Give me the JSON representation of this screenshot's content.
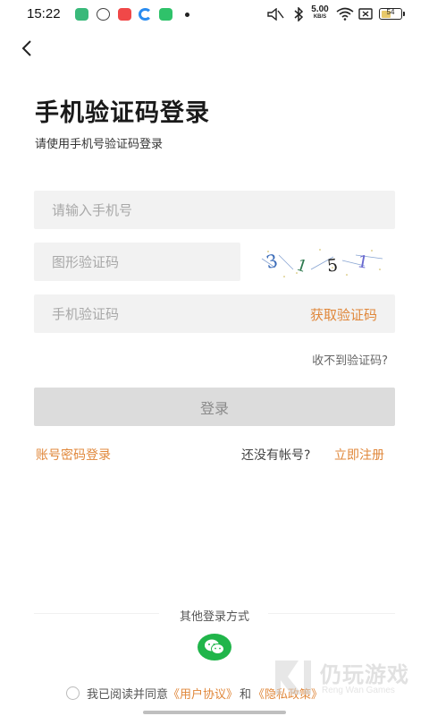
{
  "status_bar": {
    "time": "15:22",
    "net_speed": "5.00",
    "net_unit": "KB/S",
    "battery_level": "54",
    "battery_fill": 0.54,
    "app_icons": [
      {
        "name": "shield-app-icon",
        "color": "#39b97a"
      },
      {
        "name": "chat-app-icon",
        "color": "#444444"
      },
      {
        "name": "video-app-icon",
        "color": "#f04848"
      },
      {
        "name": "browser-app-icon",
        "color": "#2a8cf0"
      },
      {
        "name": "store-app-icon",
        "color": "#2fc26a"
      }
    ]
  },
  "header": {
    "back_icon": "chevron-left-icon",
    "title": "手机验证码登录",
    "subtitle": "请使用手机号验证码登录"
  },
  "form": {
    "phone_placeholder": "请输入手机号",
    "captcha_placeholder": "图形验证码",
    "sms_placeholder": "手机验证码",
    "get_code_label": "获取验证码",
    "no_code_label": "收不到验证码?",
    "login_label": "登录",
    "captcha_chars": [
      "3",
      "1",
      "5",
      "1"
    ]
  },
  "links": {
    "password_login": "账号密码登录",
    "no_account": "还没有帐号?",
    "register": "立即注册"
  },
  "other_login": {
    "label": "其他登录方式",
    "wechat_icon": "wechat-icon"
  },
  "agreement": {
    "prefix": "我已阅读并同意",
    "user_agreement": "《用户协议》",
    "and": "和",
    "privacy_policy": "《隐私政策》"
  },
  "watermark": {
    "text": "仍玩游戏",
    "sub": "Reng Wan Games"
  },
  "colors": {
    "accent": "#e0873a",
    "input_bg": "#f2f2f2",
    "button_disabled": "#dcdcdc",
    "wechat": "#20b54a"
  }
}
